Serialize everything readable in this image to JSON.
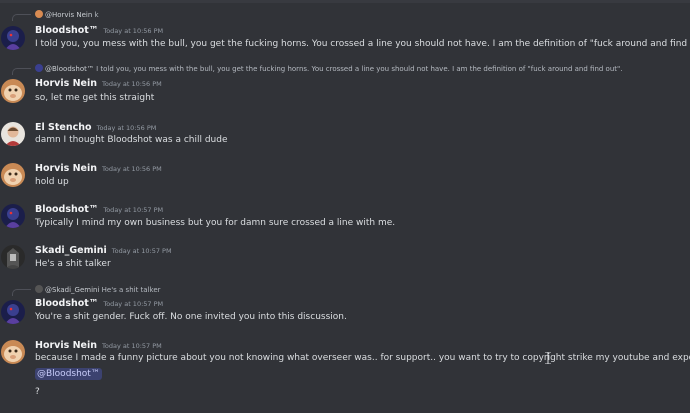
{
  "messages": [
    {
      "reply": {
        "author": "@Horvis Nein",
        "preview": "k"
      },
      "author": "Bloodshot™",
      "time": "Today at 10:56 PM",
      "lines": [
        "I told you, you mess with the bull, you get the fucking horns. You crossed a line you should not have. I am the definition of \"fuck around and find out\"."
      ]
    },
    {
      "reply": {
        "author": "@Bloodshot™",
        "preview": "I told you, you mess with the bull, you get the fucking horns. You crossed a line you should not have. I am the definition of \"fuck around and find out\"."
      },
      "author": "Horvis Nein",
      "time": "Today at 10:56 PM",
      "lines": [
        "so, let me get this straight"
      ]
    },
    {
      "author": "El Stencho",
      "time": "Today at 10:56 PM",
      "lines": [
        "damn I thought Bloodshot was a chill dude"
      ]
    },
    {
      "author": "Horvis Nein",
      "time": "Today at 10:56 PM",
      "lines": [
        "hold up"
      ]
    },
    {
      "author": "Bloodshot™",
      "time": "Today at 10:57 PM",
      "lines": [
        "Typically I mind my own business but you for damn sure crossed a line with me."
      ]
    },
    {
      "author": "Skadi_Gemini",
      "time": "Today at 10:57 PM",
      "lines": [
        "He's a shit talker"
      ]
    },
    {
      "reply": {
        "author": "@Skadi_Gemini",
        "preview": "He's a shit talker"
      },
      "author": "Bloodshot™",
      "time": "Today at 10:57 PM",
      "lines": [
        "You're a shit gender. Fuck off. No one invited you into this discussion."
      ]
    },
    {
      "author": "Horvis Nein",
      "time": "Today at 10:57 PM",
      "lines": [
        "because I made a funny picture about you not knowing what overseer was.. for support.. you want to try to copyright strike my youtube and expose me"
      ],
      "mention": "@Bloodshot™",
      "after_mention": "?"
    }
  ],
  "colors": {
    "background": "#313338",
    "username": "#f2f3f5",
    "text": "#dbdee1",
    "timestamp": "#949ba4",
    "mention_bg": "#3c4270"
  }
}
